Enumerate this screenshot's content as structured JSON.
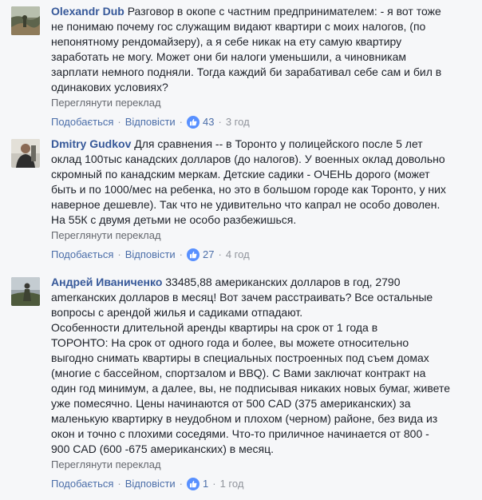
{
  "comments": [
    {
      "author": "Olexandr Dub",
      "text": "Разговор в окопе с частним предпринимателем: - я вот тоже\nне понимаю почему гос служащим видают квартири с моих налогов, (по\nнепонятному рендомайзеру), а я себе никак на ету самую квартиру\nзаработать не могу. Может они би налоги уменьшили, а чиновникам\nзарплати немного подняли. Тогда каждий би зарабативал себе сам и бил в\nодинакових условиях?",
      "translate": "Переглянути переклад",
      "like_label": "Подобається",
      "reply_label": "Відповісти",
      "likes": "43",
      "time": "3 год"
    },
    {
      "author": "Dmitry Gudkov",
      "text": "Для сравнения -- в Торонто у полицейского после 5 лет\nоклад 100тыс канадских долларов (до налогов). У военных оклад довольно\nскромный по канадским меркам. Детские садики - ОЧЕНЬ дорого (может\nбыть и по 1000/мес на ребенка, но это в большом городе как Торонто, у них\nнаверное дешевле). Так что не удивительно что капрал не особо доволен.\nНа 55К с двумя детьми не особо разбежишься.",
      "translate": "Переглянути переклад",
      "like_label": "Подобається",
      "reply_label": "Відповісти",
      "likes": "27",
      "time": "4 год"
    },
    {
      "author": "Андрей Иваниченко",
      "text": "33485,88 американских долларов в год, 2790\namerкaнских долларов в месяц! Вот зачем расстраивать? Все остальные\nвопросы с арендой жилья и садиками отпадают.\nОсобенности длительной аренды квартиры на срок от 1 года в\nТОРОНТО: На срок от одного года и более, вы можете относительно\nвыгодно снимать квартиры в специальных построенных под съем домах\n(многие с бассейном, спортзалом и BBQ). С Вами заключат контракт на\nодин год минимум, а далее, вы, не подписывая никаких новых бумаг, живете\nуже помесячно. Цены начинаются от 500 CAD (375 американских) за\nмаленькую квартирку в неудобном и плохом (черном) районе, без вида из\nокон и точно с плохими соседями. Что-то приличное начинается от 800 -\n900 CAD (600 -675 американских) в месяц.",
      "translate": "Переглянути переклад",
      "like_label": "Подобається",
      "reply_label": "Відповісти",
      "likes": "1",
      "time": "1 год"
    }
  ],
  "colors": {
    "background": "#f6f7f9",
    "author": "#365899",
    "link": "#4b6ea9",
    "meta": "#90949c",
    "like_badge": "#5890ff"
  },
  "icons": {
    "like": "thumbs-up-icon"
  }
}
